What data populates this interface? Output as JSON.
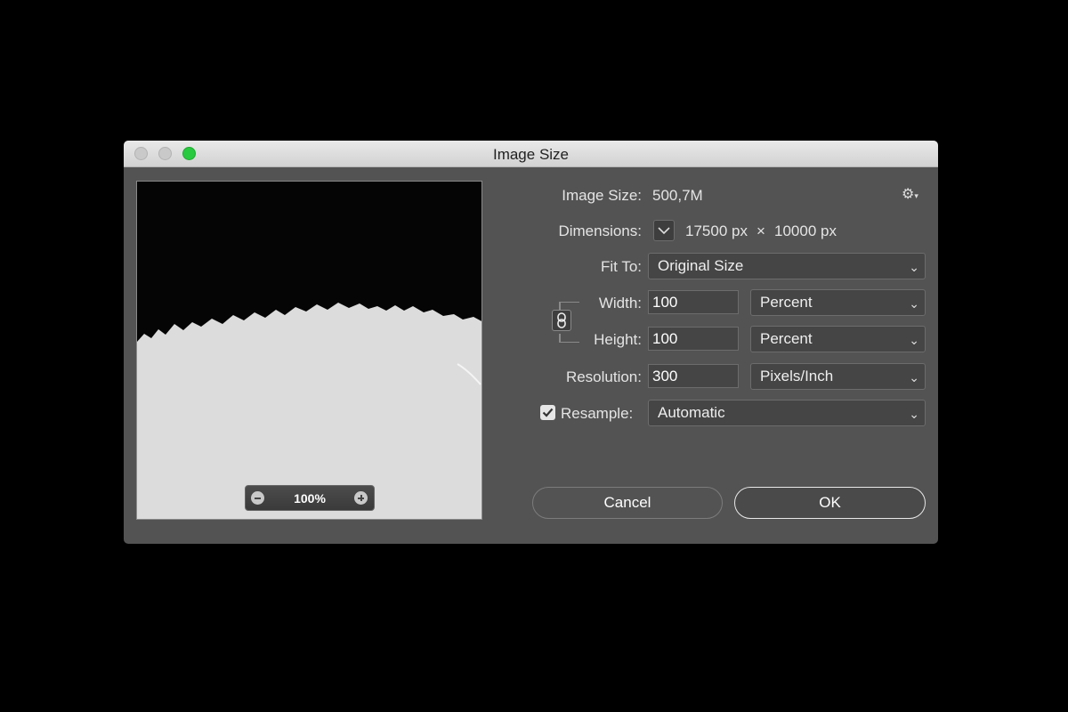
{
  "window": {
    "title": "Image Size"
  },
  "preview": {
    "zoom": "100%"
  },
  "info": {
    "image_size_label": "Image Size:",
    "image_size_value": "500,7M",
    "dimensions_label": "Dimensions:",
    "dimensions_width": "17500 px",
    "dimensions_x": "×",
    "dimensions_height": "10000 px"
  },
  "fit_to": {
    "label": "Fit To:",
    "value": "Original Size"
  },
  "width": {
    "label": "Width:",
    "value": "100",
    "unit": "Percent"
  },
  "height": {
    "label": "Height:",
    "value": "100",
    "unit": "Percent"
  },
  "resolution": {
    "label": "Resolution:",
    "value": "300",
    "unit": "Pixels/Inch"
  },
  "resample": {
    "label": "Resample:",
    "checked": true,
    "value": "Automatic"
  },
  "buttons": {
    "cancel": "Cancel",
    "ok": "OK"
  },
  "icons": {
    "settings": "gear-icon",
    "link": "chain-link-icon",
    "dropdown": "chevron-down-icon"
  },
  "colors": {
    "dialog_bg": "#535353",
    "window_green": "#29c940"
  }
}
